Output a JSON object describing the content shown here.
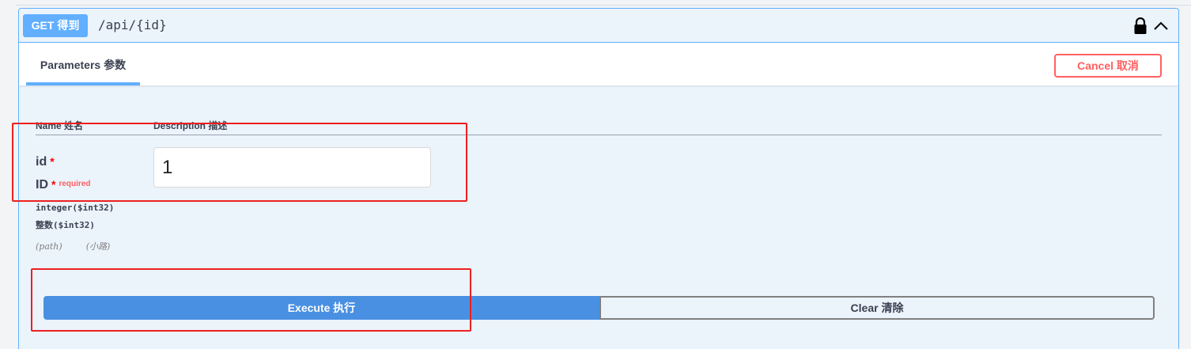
{
  "operation": {
    "method_label": "GET 得到",
    "path": "/api/{id}",
    "icons": {
      "lock": "lock-icon",
      "collapse": "chevron-up-icon"
    }
  },
  "parameters_section": {
    "tab_label": "Parameters 参数",
    "cancel_label": "Cancel 取消",
    "columns": {
      "name": "Name 姓名",
      "description": "Description 描述"
    }
  },
  "parameter": {
    "name": "id",
    "display_name": "ID",
    "required_star": "*",
    "required_label": "required",
    "type": "integer($int32)",
    "type_translated": "整数($int32)",
    "location": "(path)",
    "location_translated": "(小路)",
    "value": "1"
  },
  "actions": {
    "execute_label": "Execute 执行",
    "clear_label": "Clear 清除"
  },
  "colors": {
    "get_accent": "#61affe",
    "execute": "#4990e2",
    "cancel": "#ff6060",
    "highlight": "#ee2020"
  }
}
